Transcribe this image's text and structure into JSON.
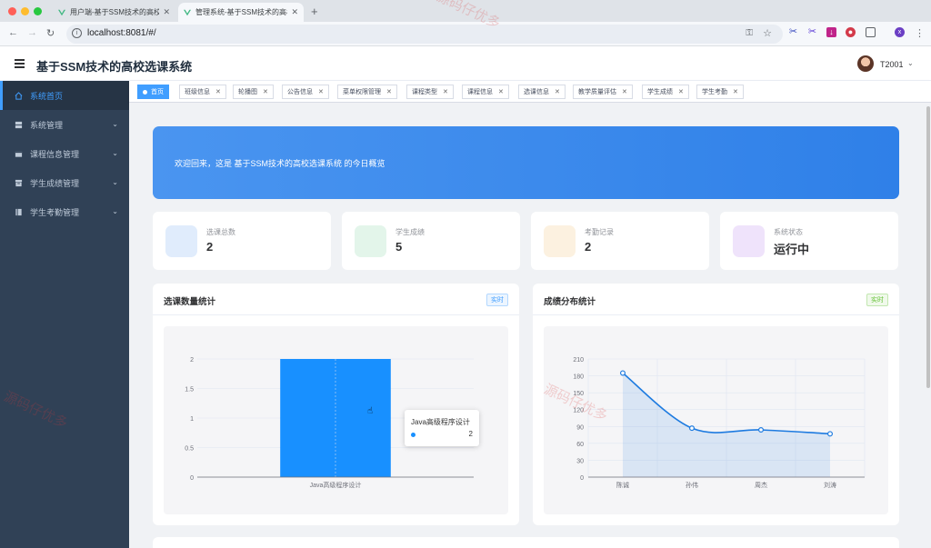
{
  "browser": {
    "tabs": [
      {
        "title": "用户端-基于SSM技术的高校选课系统",
        "active": false
      },
      {
        "title": "管理系统-基于SSM技术的高校选课系统",
        "active": true
      }
    ],
    "url": "localhost:8081/#/",
    "profile_initial": "x"
  },
  "header": {
    "title": "基于SSM技术的高校选课系统",
    "username": "T2001"
  },
  "sidebar": {
    "items": [
      {
        "label": "系统首页",
        "icon": "home-icon",
        "active": true
      },
      {
        "label": "系统管理",
        "icon": "server-icon",
        "active": false
      },
      {
        "label": "课程信息管理",
        "icon": "wallet-icon",
        "active": false
      },
      {
        "label": "学生成绩管理",
        "icon": "archive-icon",
        "active": false
      },
      {
        "label": "学生考勤管理",
        "icon": "book-icon",
        "active": false
      }
    ]
  },
  "tags": [
    {
      "label": "首页",
      "active": true
    },
    {
      "label": "班级信息"
    },
    {
      "label": "轮播图"
    },
    {
      "label": "公告信息"
    },
    {
      "label": "菜单权限管理"
    },
    {
      "label": "课程类型"
    },
    {
      "label": "课程信息"
    },
    {
      "label": "选课信息"
    },
    {
      "label": "教学质量评估"
    },
    {
      "label": "学生成绩"
    },
    {
      "label": "学生考勤"
    }
  ],
  "welcome": {
    "text": "欢迎回来，这是 基于SSM技术的高校选课系统 的今日概览"
  },
  "stats": [
    {
      "label": "选课总数",
      "value": "2",
      "color": "#e0ecfc"
    },
    {
      "label": "学生成绩",
      "value": "5",
      "color": "#e3f5ea"
    },
    {
      "label": "考勤记录",
      "value": "2",
      "color": "#fcf1e0"
    },
    {
      "label": "系统状态",
      "value": "运行中",
      "color": "#efe3fb"
    }
  ],
  "cards": {
    "left": {
      "title": "选课数量统计",
      "badge": "实时",
      "badge_color": "#409eff"
    },
    "right": {
      "title": "成绩分布统计",
      "badge": "实时",
      "badge_color": "#67c23a"
    }
  },
  "tooltip": {
    "title": "Java高级程序设计",
    "value": "2"
  },
  "watermark": "源码仔优多",
  "chart_data": [
    {
      "type": "bar",
      "categories": [
        "Java高级程序设计"
      ],
      "values": [
        2
      ],
      "ylim": [
        0,
        2
      ],
      "yticks": [
        "0",
        "0.5",
        "1",
        "1.5",
        "2"
      ],
      "color": "#1890ff"
    },
    {
      "type": "area",
      "categories": [
        "陈诚",
        "孙伟",
        "周杰",
        "刘涛"
      ],
      "values": [
        185,
        87,
        84,
        77
      ],
      "ylim": [
        0,
        210
      ],
      "yticks": [
        "0",
        "30",
        "60",
        "90",
        "120",
        "150",
        "180",
        "210"
      ],
      "color": "#1e7be0"
    }
  ]
}
